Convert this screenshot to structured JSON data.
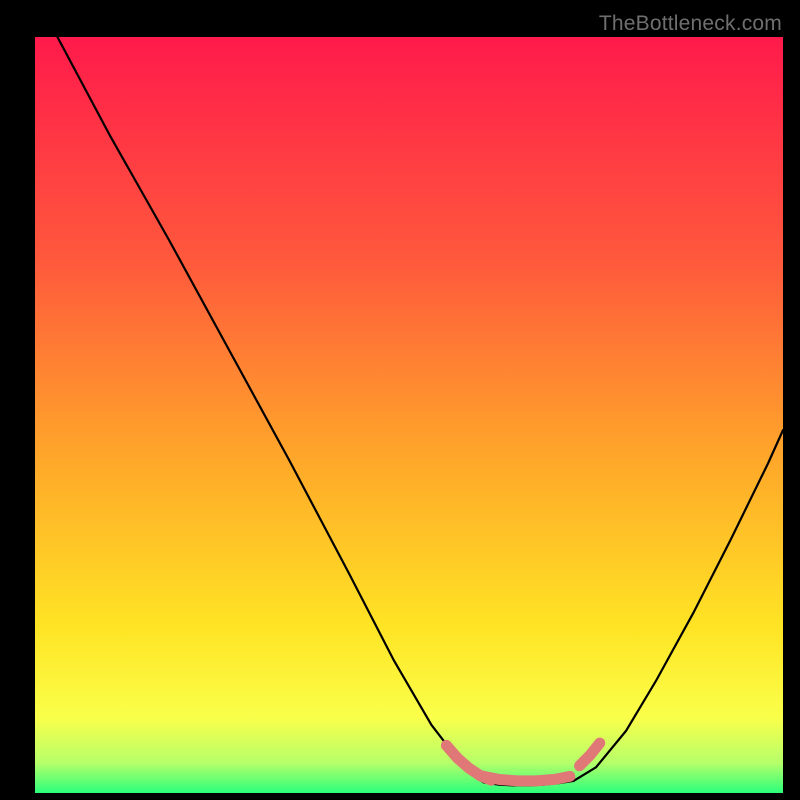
{
  "watermark": "TheBottleneck.com",
  "colors": {
    "frame": "#000000",
    "gradient_stops": [
      "#ff1a4b",
      "#ff5a3c",
      "#ffa52a",
      "#ffe424",
      "#faff4a",
      "#b6ff6a",
      "#2bff7a"
    ],
    "curve": "#000000",
    "accent": "#e07878"
  },
  "chart_data": {
    "type": "line",
    "title": "",
    "xlabel": "",
    "ylabel": "",
    "xlim": [
      0,
      100
    ],
    "ylim": [
      0,
      100
    ],
    "grid": false,
    "legend": false,
    "series": [
      {
        "name": "left-branch",
        "x": [
          3,
          10,
          18,
          26,
          34,
          42,
          48,
          53,
          56.5,
          58.5,
          60
        ],
        "y": [
          100,
          87,
          73,
          58.5,
          44,
          29,
          17.5,
          9,
          4.5,
          2.3,
          1.4
        ]
      },
      {
        "name": "valley",
        "x": [
          60,
          62,
          64,
          66,
          68,
          70,
          72
        ],
        "y": [
          1.4,
          1.1,
          1.0,
          1.0,
          1.1,
          1.3,
          1.6
        ]
      },
      {
        "name": "right-branch",
        "x": [
          72,
          75,
          79,
          83,
          88,
          93,
          98,
          100
        ],
        "y": [
          1.6,
          3.4,
          8.2,
          14.8,
          23.8,
          33.5,
          43.6,
          48
        ]
      },
      {
        "name": "accent-left",
        "x": [
          55,
          56.5,
          58,
          59.5,
          61
        ],
        "y": [
          6.3,
          4.6,
          3.3,
          2.3,
          1.7
        ]
      },
      {
        "name": "accent-bottom",
        "x": [
          59.5,
          62,
          64.5,
          67,
          69.5,
          71.5
        ],
        "y": [
          2.3,
          1.8,
          1.6,
          1.6,
          1.8,
          2.2
        ]
      },
      {
        "name": "accent-right",
        "x": [
          72.8,
          74.2,
          75.5
        ],
        "y": [
          3.6,
          5.0,
          6.6
        ]
      }
    ],
    "annotations": []
  }
}
